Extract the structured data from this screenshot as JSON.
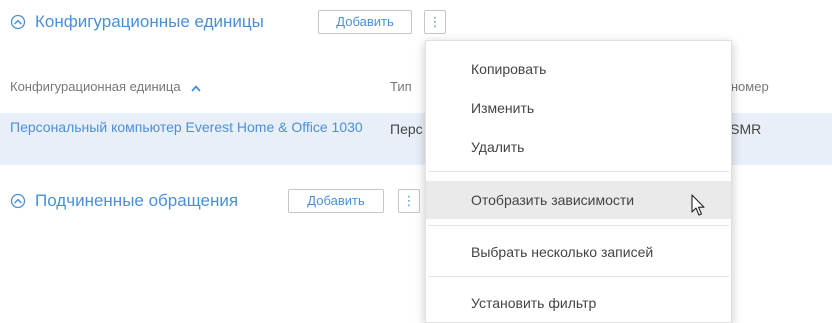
{
  "sections": {
    "config_items": {
      "title": "Конфигурационные единицы",
      "add_label": "Добавить",
      "more_label": "⋮"
    },
    "child_requests": {
      "title": "Подчиненные обращения",
      "add_label": "Добавить",
      "more_label": "⋮"
    }
  },
  "grid": {
    "columns": [
      {
        "label": "Конфигурационная единица",
        "sort": "ascending"
      },
      {
        "label": "Тип"
      },
      {
        "label": "Инвентарный номер",
        "visible_part": "й номер"
      }
    ],
    "rows": [
      {
        "name": "Персональный компьютер Everest Home & Office 1030",
        "type": "Перс",
        "inventory_number": "USMR"
      }
    ]
  },
  "context_menu": {
    "items": [
      {
        "label": "Копировать"
      },
      {
        "label": "Изменить"
      },
      {
        "label": "Удалить"
      },
      {
        "label": "Отобразить зависимости",
        "highlighted": true
      },
      {
        "label": "Выбрать несколько записей"
      },
      {
        "label": "Установить фильтр"
      }
    ]
  },
  "colors": {
    "accent": "#4a90d9",
    "text": "#444444",
    "muted": "#777777",
    "row_selected": "#e9eff9",
    "menu_hover": "#eaeaea"
  },
  "icons": {
    "collapse": "chevron-up-circle-icon",
    "sort": "chevron-up-icon",
    "cursor": "mouse-pointer-icon"
  }
}
